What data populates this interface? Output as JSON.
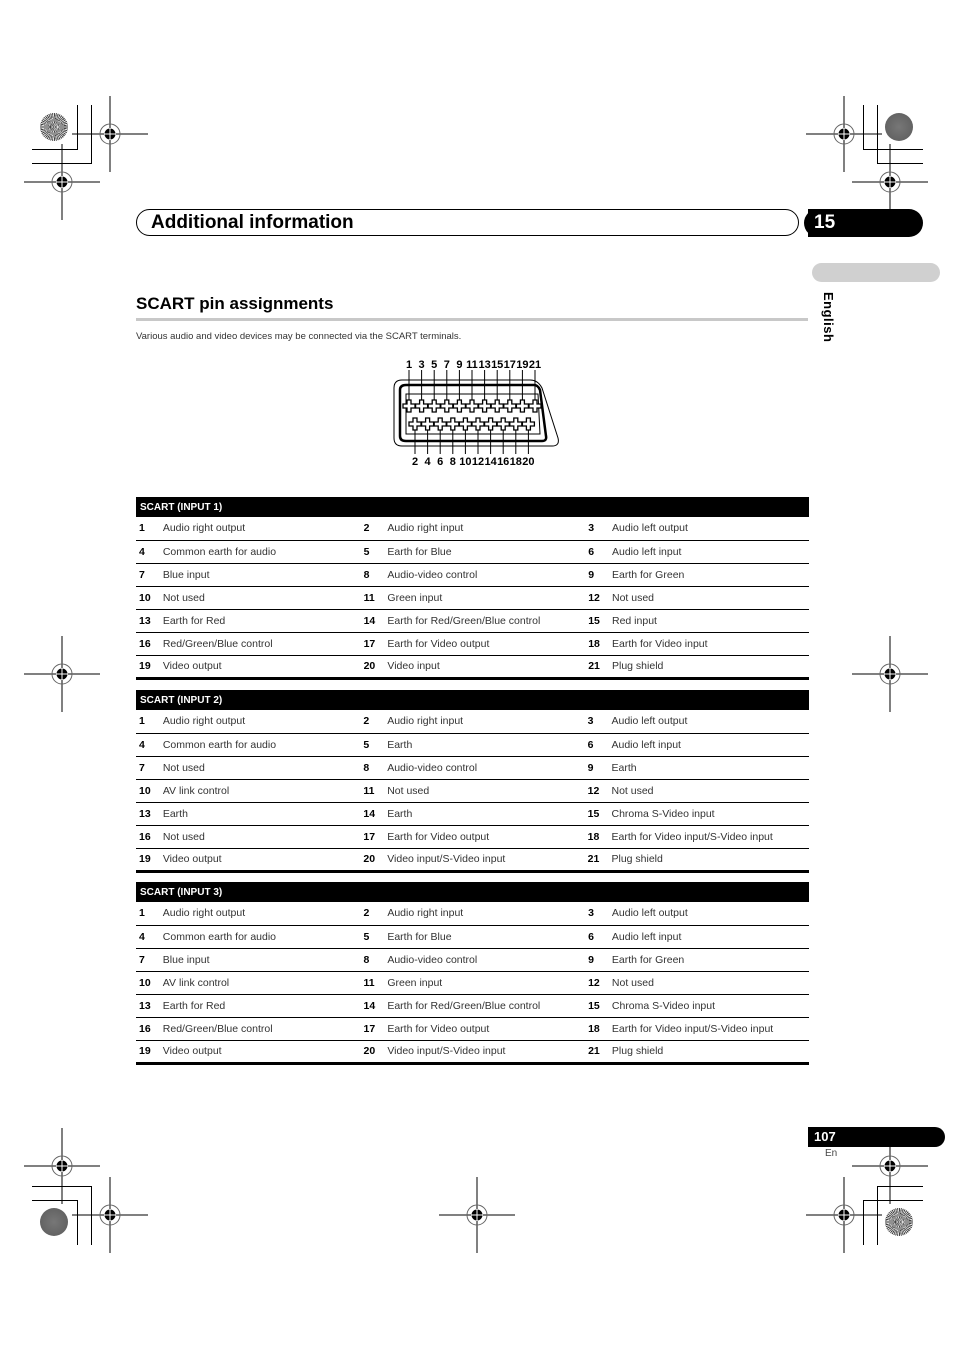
{
  "header": {
    "chapter_title": "Additional information",
    "chapter_number": "15"
  },
  "side_tab": {
    "language": "English"
  },
  "section": {
    "title": "SCART pin assignments",
    "intro": "Various audio and video devices may be connected via the SCART terminals."
  },
  "diagram": {
    "top_pins": [
      "1",
      "3",
      "5",
      "7",
      "9",
      "11",
      "13",
      "15",
      "17",
      "19",
      "21"
    ],
    "bottom_pins": [
      "2",
      "4",
      "6",
      "8",
      "10",
      "12",
      "14",
      "16",
      "18",
      "20"
    ]
  },
  "tables": [
    {
      "title": "SCART (INPUT 1)",
      "rows": [
        [
          {
            "pin": "1",
            "desc": "Audio right output"
          },
          {
            "pin": "2",
            "desc": "Audio right input"
          },
          {
            "pin": "3",
            "desc": "Audio left output"
          }
        ],
        [
          {
            "pin": "4",
            "desc": "Common earth for audio"
          },
          {
            "pin": "5",
            "desc": "Earth for Blue"
          },
          {
            "pin": "6",
            "desc": "Audio left input"
          }
        ],
        [
          {
            "pin": "7",
            "desc": "Blue input"
          },
          {
            "pin": "8",
            "desc": "Audio-video control"
          },
          {
            "pin": "9",
            "desc": "Earth for Green"
          }
        ],
        [
          {
            "pin": "10",
            "desc": "Not used"
          },
          {
            "pin": "11",
            "desc": "Green input"
          },
          {
            "pin": "12",
            "desc": "Not used"
          }
        ],
        [
          {
            "pin": "13",
            "desc": "Earth for Red"
          },
          {
            "pin": "14",
            "desc": "Earth for Red/Green/Blue control"
          },
          {
            "pin": "15",
            "desc": "Red input"
          }
        ],
        [
          {
            "pin": "16",
            "desc": "Red/Green/Blue control"
          },
          {
            "pin": "17",
            "desc": "Earth for Video output"
          },
          {
            "pin": "18",
            "desc": "Earth for Video input"
          }
        ],
        [
          {
            "pin": "19",
            "desc": "Video output"
          },
          {
            "pin": "20",
            "desc": "Video input"
          },
          {
            "pin": "21",
            "desc": "Plug shield"
          }
        ]
      ]
    },
    {
      "title": "SCART (INPUT 2)",
      "rows": [
        [
          {
            "pin": "1",
            "desc": "Audio right output"
          },
          {
            "pin": "2",
            "desc": "Audio right input"
          },
          {
            "pin": "3",
            "desc": "Audio left output"
          }
        ],
        [
          {
            "pin": "4",
            "desc": "Common earth for audio"
          },
          {
            "pin": "5",
            "desc": "Earth"
          },
          {
            "pin": "6",
            "desc": "Audio left input"
          }
        ],
        [
          {
            "pin": "7",
            "desc": "Not used"
          },
          {
            "pin": "8",
            "desc": "Audio-video control"
          },
          {
            "pin": "9",
            "desc": "Earth"
          }
        ],
        [
          {
            "pin": "10",
            "desc": "AV link control"
          },
          {
            "pin": "11",
            "desc": "Not used"
          },
          {
            "pin": "12",
            "desc": "Not used"
          }
        ],
        [
          {
            "pin": "13",
            "desc": "Earth"
          },
          {
            "pin": "14",
            "desc": "Earth"
          },
          {
            "pin": "15",
            "desc": "Chroma S-Video input"
          }
        ],
        [
          {
            "pin": "16",
            "desc": "Not used"
          },
          {
            "pin": "17",
            "desc": "Earth for Video output"
          },
          {
            "pin": "18",
            "desc": "Earth for Video input/S-Video input"
          }
        ],
        [
          {
            "pin": "19",
            "desc": "Video output"
          },
          {
            "pin": "20",
            "desc": "Video input/S-Video input"
          },
          {
            "pin": "21",
            "desc": "Plug shield"
          }
        ]
      ]
    },
    {
      "title": "SCART (INPUT 3)",
      "rows": [
        [
          {
            "pin": "1",
            "desc": "Audio right output"
          },
          {
            "pin": "2",
            "desc": "Audio right input"
          },
          {
            "pin": "3",
            "desc": "Audio left output"
          }
        ],
        [
          {
            "pin": "4",
            "desc": "Common earth for audio"
          },
          {
            "pin": "5",
            "desc": "Earth for Blue"
          },
          {
            "pin": "6",
            "desc": "Audio left input"
          }
        ],
        [
          {
            "pin": "7",
            "desc": "Blue input"
          },
          {
            "pin": "8",
            "desc": "Audio-video control"
          },
          {
            "pin": "9",
            "desc": "Earth for Green"
          }
        ],
        [
          {
            "pin": "10",
            "desc": "AV link control"
          },
          {
            "pin": "11",
            "desc": "Green input"
          },
          {
            "pin": "12",
            "desc": "Not used"
          }
        ],
        [
          {
            "pin": "13",
            "desc": "Earth for Red"
          },
          {
            "pin": "14",
            "desc": "Earth for Red/Green/Blue control"
          },
          {
            "pin": "15",
            "desc": "Chroma S-Video input"
          }
        ],
        [
          {
            "pin": "16",
            "desc": "Red/Green/Blue control"
          },
          {
            "pin": "17",
            "desc": "Earth for Video output"
          },
          {
            "pin": "18",
            "desc": "Earth for Video input/S-Video input"
          }
        ],
        [
          {
            "pin": "19",
            "desc": "Video output"
          },
          {
            "pin": "20",
            "desc": "Video input/S-Video input"
          },
          {
            "pin": "21",
            "desc": "Plug shield"
          }
        ]
      ]
    }
  ],
  "footer": {
    "page_number": "107",
    "language_code": "En"
  }
}
